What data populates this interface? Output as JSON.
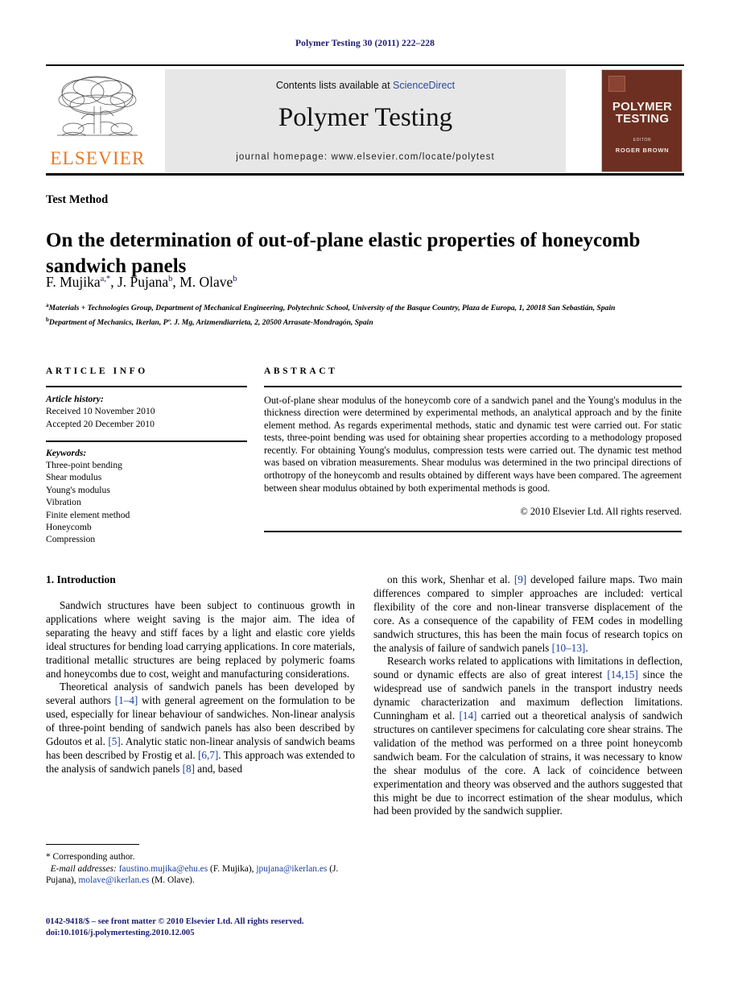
{
  "running_head": "Polymer Testing 30 (2011) 222–228",
  "masthead": {
    "contents_prefix": "Contents lists available at ",
    "sciencedirect": "ScienceDirect",
    "journal_name": "Polymer Testing",
    "homepage": "journal homepage: www.elsevier.com/locate/polytest",
    "publisher_wordmark": "ELSEVIER",
    "publisher_color": "#E87722",
    "cover": {
      "title_line1": "POLYMER",
      "title_line2": "TESTING",
      "editor_label": "EDITOR",
      "editor_name": "ROGER BROWN",
      "background_color": "#6d2f22"
    }
  },
  "article": {
    "kicker": "Test Method",
    "title": "On the determination of out-of-plane elastic properties of honeycomb sandwich panels",
    "authors_html": "F. Mujika<sup>a,*</sup>, J. Pujana<sup>b</sup>, M. Olave<sup>b</sup>",
    "affiliation_a": "Materials + Technologies Group, Department of Mechanical Engineering, Polytechnic School, University of the Basque Country, Plaza de Europa, 1, 20018 San Sebastián, Spain",
    "affiliation_b": "Department of Mechanics, Ikerlan, Pº. J. Mg, Arizmendiarrieta, 2, 20500 Arrasate-Mondragón, Spain",
    "affiliation_a_marker": "a",
    "affiliation_b_marker": "b"
  },
  "info": {
    "heading": "ARTICLE INFO",
    "history_label": "Article history:",
    "received": "Received 10 November 2010",
    "accepted": "Accepted 20 December 2010",
    "keywords_label": "Keywords:",
    "keywords": [
      "Three-point bending",
      "Shear modulus",
      "Young's modulus",
      "Vibration",
      "Finite element method",
      "Honeycomb",
      "Compression"
    ]
  },
  "abstract": {
    "heading": "ABSTRACT",
    "text": "Out-of-plane shear modulus of the honeycomb core of a sandwich panel and the Young's modulus in the thickness direction were determined by experimental methods, an analytical approach and by the finite element method. As regards experimental methods, static and dynamic test were carried out. For static tests, three-point bending was used for obtaining shear properties according to a methodology proposed recently. For obtaining Young's modulus, compression tests were carried out. The dynamic test method was based on vibration measurements. Shear modulus was determined in the two principal directions of orthotropy of the honeycomb and results obtained by different ways have been compared. The agreement between shear modulus obtained by both experimental methods is good.",
    "copyright": "© 2010 Elsevier Ltd. All rights reserved."
  },
  "body": {
    "section_number_title": "1. Introduction",
    "left_paragraphs": [
      "Sandwich structures have been subject to continuous growth in applications where weight saving is the major aim. The idea of separating the heavy and stiff faces by a light and elastic core yields ideal structures for bending load carrying applications. In core materials, traditional metallic structures are being replaced by polymeric foams and honeycombs due to cost, weight and manufacturing considerations."
    ],
    "left_paragraph_2_parts": [
      "Theoretical analysis of sandwich panels has been developed by several authors ",
      "[1–4]",
      " with general agreement on the formulation to be used, especially for linear behaviour of sandwiches. Non-linear analysis of three-point bending of sandwich panels has also been described by Gdoutos et al. ",
      "[5]",
      ". Analytic static non-linear analysis of sandwich beams has been described by Frostig et al. ",
      "[6,7]",
      ". This approach was extended to the analysis of sandwich panels ",
      "[8]",
      " and, based"
    ],
    "right_paragraph_1_parts": [
      "on this work, Shenhar et al. ",
      "[9]",
      " developed failure maps. Two main differences compared to simpler approaches are included: vertical flexibility of the core and non-linear transverse displacement of the core. As a consequence of the capability of FEM codes in modelling sandwich structures, this has been the main focus of research topics on the analysis of failure of sandwich panels ",
      "[10–13]",
      "."
    ],
    "right_paragraph_2_parts": [
      "Research works related to applications with limitations in deflection, sound or dynamic effects are also of great interest ",
      "[14,15]",
      " since the widespread use of sandwich panels in the transport industry needs dynamic characterization and maximum deflection limitations. Cunningham et al. ",
      "[14]",
      " carried out a theoretical analysis of sandwich structures on cantilever specimens for calculating core shear strains. The validation of the method was performed on a three point honeycomb sandwich beam. For the calculation of strains, it was necessary to know the shear modulus of the core. A lack of coincidence between experimentation and theory was observed and the authors suggested that this might be due to incorrect estimation of the shear modulus, which had been provided by the sandwich supplier."
    ]
  },
  "footnote": {
    "corresponding": "* Corresponding author.",
    "email_label": "E-mail addresses:",
    "email_1": "faustino.mujika@ehu.es",
    "email_1_owner": "(F. Mujika),",
    "email_2": "jpujana@ikerlan.es",
    "email_2_owner": "(J. Pujana),",
    "email_3": "molave@ikerlan.es",
    "email_3_owner": "(M. Olave)."
  },
  "imprint": {
    "line1": "0142-9418/$ – see front matter © 2010 Elsevier Ltd. All rights reserved.",
    "doi_prefix": "doi:",
    "doi": "10.1016/j.polymertesting.2010.12.005"
  }
}
